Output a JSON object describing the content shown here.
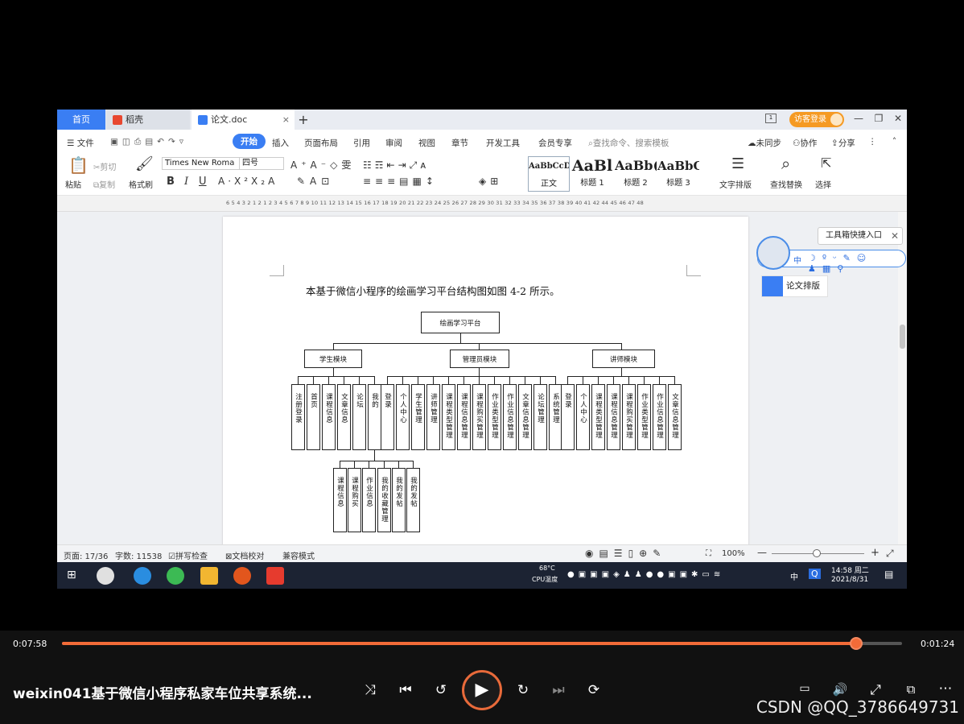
{
  "tabs": {
    "home": "首页",
    "daoke": "稻壳",
    "doc": "论文.doc",
    "plus": "+"
  },
  "title_right": {
    "login": "访客登录"
  },
  "menu": {
    "file": "文件",
    "start": "开始",
    "insert": "插入",
    "layout": "页面布局",
    "ref": "引用",
    "review": "审阅",
    "view": "视图",
    "chapter": "章节",
    "dev": "开发工具",
    "vip": "会员专享",
    "search": "查找命令、搜索模板",
    "sync": "未同步",
    "collab": "协作",
    "share": "分享"
  },
  "ribbon": {
    "paste": "粘贴",
    "cut": "剪切",
    "copy": "复制",
    "format_painter": "格式刷",
    "font": "Times New Roma",
    "size": "四号",
    "bold": "B",
    "italic": "I",
    "underline": "U",
    "styles": [
      {
        "preview": "AaBbCcDd",
        "name": "正文"
      },
      {
        "preview": "AaBl",
        "name": "标题 1"
      },
      {
        "preview": "AaBb(",
        "name": "标题 2"
      },
      {
        "preview": "AaBbC",
        "name": "标题 3"
      }
    ],
    "text_layout": "文字排版",
    "find_replace": "查找替换",
    "select": "选择"
  },
  "ruler": "6 5 4 3 2 1 2 1 2 3 4 5 6 7 8 9 10 11 12 13 14 15 16 17 18 19 20 21 22 23 24 25 26 27 28 29 30 31 32 33 34 35 36 37 38 39 40 41 42 44 45 46 47 48",
  "document": {
    "caption": "本基于微信小程序的绘画学习平台结构图如图 4-2 所示。",
    "root": "绘画学习平台",
    "modules": [
      "学生模块",
      "管理员模块",
      "讲师模块"
    ],
    "student_leaves": [
      "注册登录",
      "首页",
      "课程信息",
      "文章信息",
      "论坛",
      "我的"
    ],
    "mine_children": [
      "课程信息",
      "课程购买",
      "作业信息",
      "我的收藏管理",
      "我的发帖",
      "我的发帖"
    ],
    "admin_leaves": [
      "登录",
      "个人中心",
      "学生管理",
      "讲师管理",
      "课程类型管理",
      "课程信息管理",
      "课程购买管理",
      "作业类型管理",
      "作业信息管理",
      "文章信息管理",
      "论坛管理",
      "系统管理"
    ],
    "teacher_leaves": [
      "登录",
      "个人中心",
      "课程类型管理",
      "课程信息管理",
      "课程购买管理",
      "作业类型管理",
      "作业信息管理",
      "文章信息管理"
    ]
  },
  "side": {
    "toolbox": "工具箱快捷入口",
    "paper_layout": "论文排版",
    "ime": "中"
  },
  "status": {
    "page": "页面: 17/36",
    "words": "字数: 11538",
    "spell": "拼写检查",
    "proof": "文档校对",
    "compat": "兼容模式",
    "zoom": "100%"
  },
  "taskbar": {
    "temp": "68°C",
    "cpu": "CPU温度",
    "ime": "中",
    "time": "14:58 周二",
    "date": "2021/8/31"
  },
  "player": {
    "elapsed": "0:07:58",
    "remaining": "0:01:24",
    "progress": 0.945,
    "title": "weixin041基于微信小程序私家车位共享系统...",
    "watermark": "CSDN @QQ_3786649731"
  }
}
